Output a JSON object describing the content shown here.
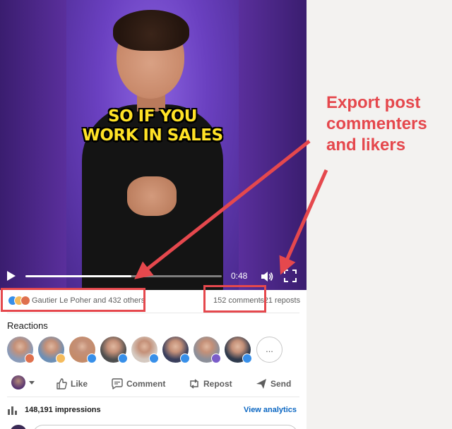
{
  "video": {
    "caption_line1": "SO IF YOU",
    "caption_line2": "WORK IN SALES",
    "progress_fraction": 0.54,
    "time": "0:48"
  },
  "social": {
    "reactions_text": "Gautier Le Poher and 432 others",
    "comments_text": "152 comments",
    "reposts_text": "21 reposts",
    "separator": "·"
  },
  "reactions": {
    "title": "Reactions",
    "more_label": "...",
    "avatars": [
      {
        "bg": "#8a9bb8",
        "badge": "#df704d"
      },
      {
        "bg": "#6d8fb5",
        "badge": "#f5bb5c"
      },
      {
        "bg": "#c48b6a",
        "badge": "#378fe9"
      },
      {
        "bg": "#4e4e4e",
        "badge": "#378fe9"
      },
      {
        "bg": "#d5c9c0",
        "badge": "#378fe9"
      },
      {
        "bg": "#3a3f5c",
        "badge": "#378fe9"
      },
      {
        "bg": "#8c8f99",
        "badge": "#7a5cc9"
      },
      {
        "bg": "#2f3a4c",
        "badge": "#378fe9"
      }
    ]
  },
  "actions": {
    "like": "Like",
    "comment": "Comment",
    "repost": "Repost",
    "send": "Send"
  },
  "impressions": {
    "text": "148,191 impressions",
    "analytics_link": "View analytics"
  },
  "annotation": {
    "line1": "Export post",
    "line2": "commenters",
    "line3": "and likers",
    "color": "#e5484d"
  },
  "colors": {
    "brand_blue": "#0a66c2",
    "like_blue": "#378fe9",
    "annotation_red": "#e5484d"
  }
}
